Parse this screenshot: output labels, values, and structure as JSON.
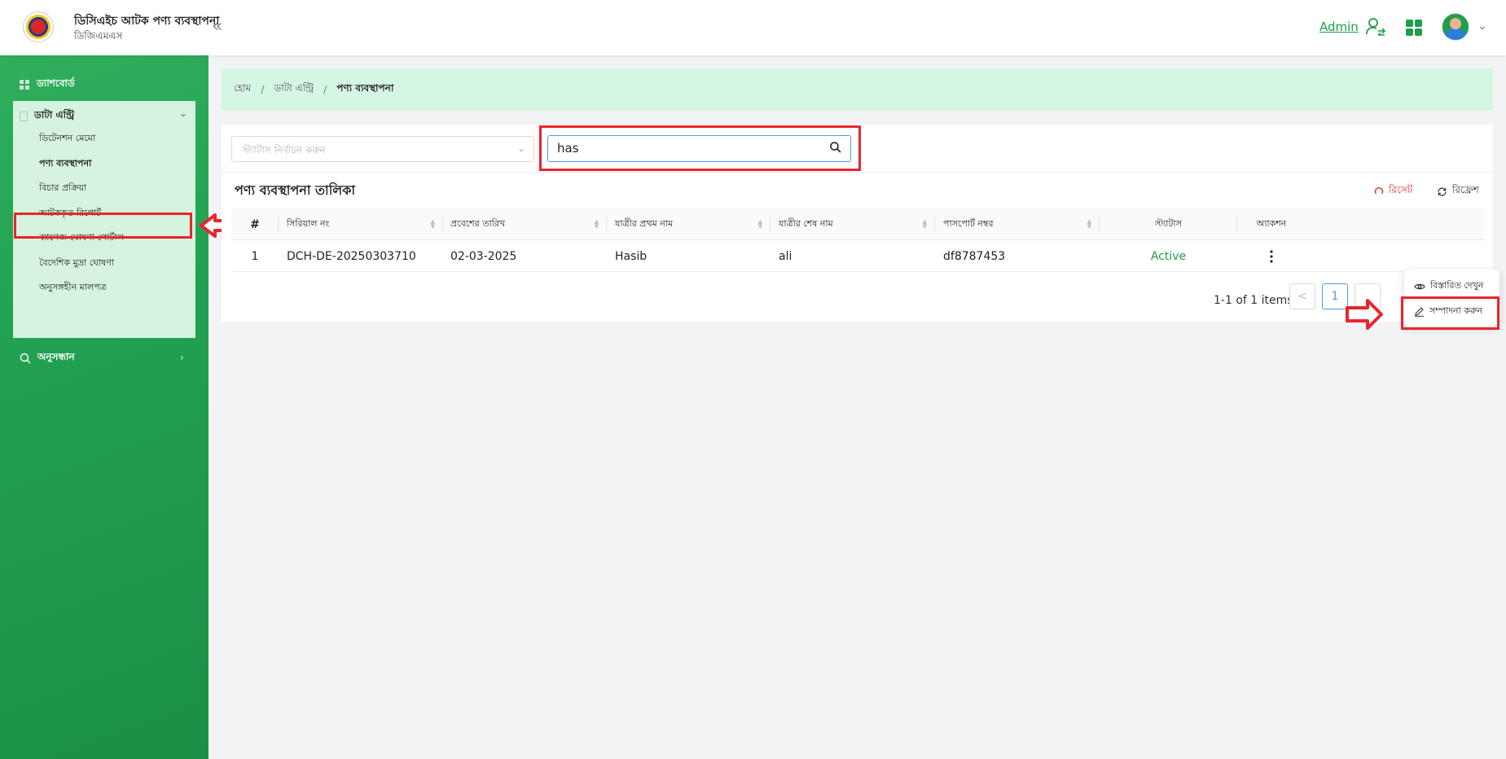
{
  "header": {
    "title": "ডিসিএইচ আটক পণ্য ব্যবস্থাপনা",
    "subtitle": "ডিজিএমএস",
    "admin_label": "Admin"
  },
  "sidebar": {
    "dashboard": "ড্যাশবোর্ড",
    "data_entry": "ডাটা এন্ট্রি",
    "items": [
      {
        "label": "ডিটেনশন মেমো"
      },
      {
        "label": "পণ্য ব্যবস্থাপনা"
      },
      {
        "label": "বিচার প্রক্রিয়া"
      },
      {
        "label": "আটককৃত রিপোর্ট"
      },
      {
        "label": "ব্যাগেজ ঘোষণা পোর্টাল"
      },
      {
        "label": "বৈদেশিক মুদ্রা ঘোষণা"
      },
      {
        "label": "অনুসঙ্গহীন মালপত্র"
      }
    ],
    "search": "অনুসন্ধান"
  },
  "breadcrumb": {
    "home": "হোম",
    "data_entry": "ডাটা এন্ট্রি",
    "current": "পণ্য ব্যবস্থাপনা",
    "sep": "/"
  },
  "filters": {
    "status_placeholder": "স্ট্যাটাস নির্বাচন করুন",
    "search_value": "has"
  },
  "table": {
    "title": "পণ্য ব্যবস্থাপনা তালিকা",
    "reset_label": "রিসেট",
    "refresh_label": "রিফ্রেশ",
    "columns": [
      "#",
      "সিরিয়াল নং",
      "প্রবেশের তারিখ",
      "যাত্রীর প্রথম নাম",
      "যাত্রীর শেষ নাম",
      "পাসপোর্ট নম্বর",
      "স্ট্যাটাস",
      "অ্যাকশন"
    ],
    "rows": [
      {
        "index": "1",
        "serial": "DCH-DE-20250303710",
        "date": "02-03-2025",
        "first_name": "Hasib",
        "last_name": "ali",
        "passport": "df8787453",
        "status": "Active"
      }
    ]
  },
  "pagination": {
    "summary": "1-1 of 1 items",
    "current_page": "1",
    "prev": "<"
  },
  "action_menu": {
    "view_details": "বিস্তারিত দেখুন",
    "edit": "সম্পাদনা করুন"
  },
  "colors": {
    "brand_green": "#1f9e4b",
    "highlight_red": "#e8262b",
    "status_active": "#1f9e4b"
  }
}
